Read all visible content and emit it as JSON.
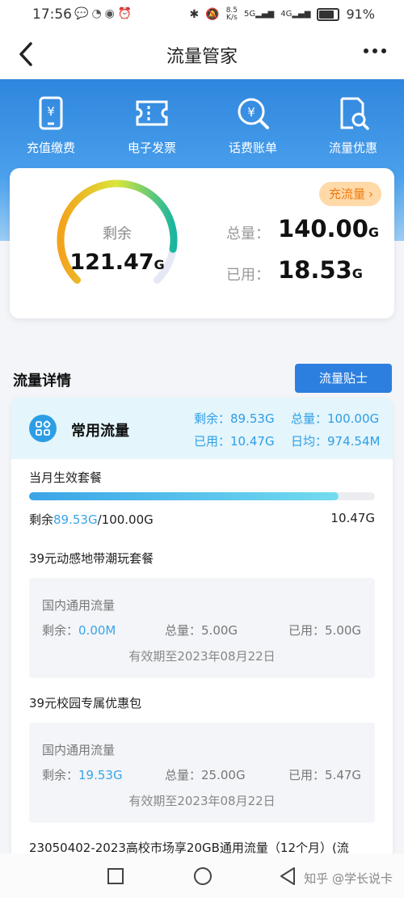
{
  "status": {
    "time": "17:56",
    "net_speed_top": "8.5",
    "net_speed_bottom": "K/s",
    "sig1": "5G",
    "sig2": "4G",
    "battery": "91%"
  },
  "nav": {
    "title": "流量管家"
  },
  "quick_actions": [
    {
      "label": "充值缴费",
      "icon": "phone-yuan-icon"
    },
    {
      "label": "电子发票",
      "icon": "ticket-icon"
    },
    {
      "label": "话费账单",
      "icon": "search-yuan-icon"
    },
    {
      "label": "流量优惠",
      "icon": "doc-search-icon"
    }
  ],
  "summary": {
    "recharge_label": "充流量",
    "remain_label": "剩余",
    "remain_value": "121.47",
    "remain_unit": "G",
    "remain_fraction": 0.8676,
    "total_label": "总量：",
    "total_value": "140.00",
    "total_unit": "G",
    "used_label": "已用：",
    "used_value": "18.53",
    "used_unit": "G"
  },
  "detail": {
    "title": "流量详情",
    "tips_button": "流量贴士",
    "common": {
      "title": "常用流量",
      "remain": "剩余：",
      "remain_val": "89.53G",
      "total": "总量：",
      "total_val": "100.00G",
      "used": "已用：",
      "used_val": "10.47G",
      "daily": "日均：",
      "daily_val": "974.54M"
    },
    "current_pkg": {
      "title": "当月生效套餐",
      "progress": 0.8953,
      "remain_prefix": "剩余",
      "remain_val": "89.53G",
      "total_suffix": "/100.00G",
      "used_val": "10.47G"
    },
    "packages": [
      {
        "name": "39元动感地带潮玩套餐",
        "type": "国内通用流量",
        "remain_label": "剩余：",
        "remain_val": "0.00M",
        "total_label": "总量：",
        "total_val": "5.00G",
        "used_label": "已用：",
        "used_val": "5.00G",
        "validity": "有效期至2023年08月22日"
      },
      {
        "name": "39元校园专属优惠包",
        "type": "国内通用流量",
        "remain_label": "剩余：",
        "remain_val": "19.53G",
        "total_label": "总量：",
        "total_val": "25.00G",
        "used_label": "已用：",
        "used_val": "5.47G",
        "validity": "有效期至2023年08月22日"
      }
    ],
    "third_pkg_name": "23050402-2023高校市场享20GB通用流量（12个月）(流"
  },
  "watermark": "知乎 @学长说卡"
}
